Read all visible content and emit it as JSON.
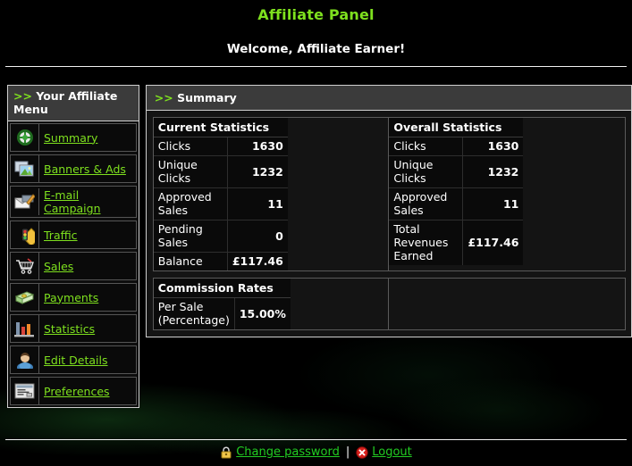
{
  "header": {
    "app_title": "Affiliate Panel",
    "welcome": "Welcome, Affiliate Earner!",
    "title_color": "#7ee01e"
  },
  "sidebar": {
    "heading_arrows": ">>",
    "heading": "Your Affiliate Menu",
    "items": [
      {
        "label": "Summary",
        "icon": "globe-icon"
      },
      {
        "label": "Banners & Ads",
        "icon": "images-icon"
      },
      {
        "label": "E-mail Campaign",
        "icon": "email-pencil-icon"
      },
      {
        "label": "Traffic",
        "icon": "traffic-light-icon"
      },
      {
        "label": "Sales",
        "icon": "shopping-cart-icon"
      },
      {
        "label": "Payments",
        "icon": "money-icon"
      },
      {
        "label": "Statistics",
        "icon": "bar-chart-icon"
      },
      {
        "label": "Edit Details",
        "icon": "user-icon"
      },
      {
        "label": "Preferences",
        "icon": "form-window-icon"
      }
    ]
  },
  "content": {
    "heading_arrows": ">>",
    "heading": "Summary",
    "current_statistics": {
      "title": "Current Statistics",
      "rows": [
        {
          "label": "Clicks",
          "value": "1630"
        },
        {
          "label": "Unique Clicks",
          "value": "1232"
        },
        {
          "label": "Approved Sales",
          "value": "11"
        },
        {
          "label": "Pending Sales",
          "value": "0"
        },
        {
          "label": "Balance",
          "value": "£117.46"
        }
      ]
    },
    "overall_statistics": {
      "title": "Overall Statistics",
      "rows": [
        {
          "label": "Clicks",
          "value": "1630"
        },
        {
          "label": "Unique Clicks",
          "value": "1232"
        },
        {
          "label": "Approved Sales",
          "value": "11"
        },
        {
          "label": "Total Revenues Earned",
          "value": "£117.46"
        }
      ]
    },
    "commission_rates": {
      "title": "Commission Rates",
      "rows": [
        {
          "label": "Per Sale (Percentage)",
          "value": "15.00%"
        }
      ]
    }
  },
  "footer": {
    "change_password": "Change password",
    "separator": "|",
    "logout": "Logout",
    "link_color": "#22cc22"
  }
}
